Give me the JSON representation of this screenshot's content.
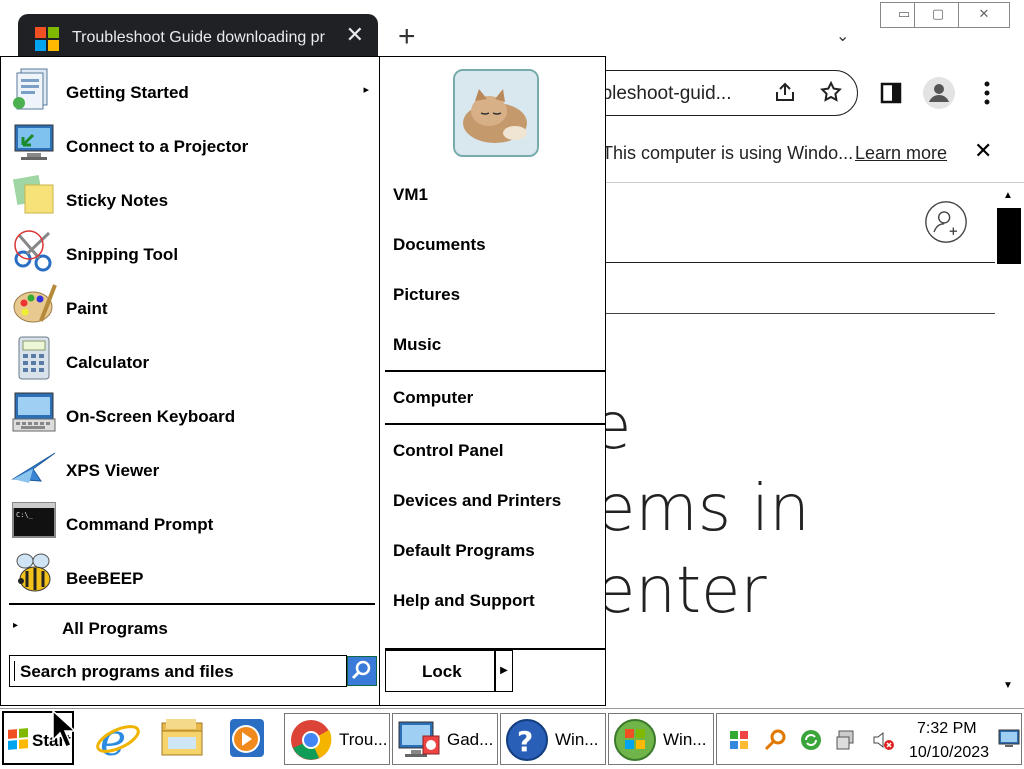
{
  "browser": {
    "tab_title": "Troubleshoot Guide downloading pr",
    "tab_close": "✕",
    "new_tab": "+",
    "tab_search": "⌄",
    "window_controls": {
      "minimize": "▭",
      "maximize": "▢",
      "close": "✕"
    },
    "omnibox_text": "ubleshoot-guid...",
    "infobar_text": "This computer is using Windo...",
    "infobar_link": "Learn more",
    "infobar_close": "✕",
    "page_heading_lines": [
      "e",
      "ems in",
      "enter"
    ]
  },
  "start_menu": {
    "programs": [
      {
        "label": "Getting Started",
        "icon": "getting-started-icon",
        "has_submenu": true
      },
      {
        "label": "Connect to a Projector",
        "icon": "projector-icon"
      },
      {
        "label": "Sticky Notes",
        "icon": "sticky-notes-icon"
      },
      {
        "label": "Snipping Tool",
        "icon": "scissors-icon"
      },
      {
        "label": "Paint",
        "icon": "paint-palette-icon"
      },
      {
        "label": "Calculator",
        "icon": "calculator-icon"
      },
      {
        "label": "On-Screen Keyboard",
        "icon": "keyboard-icon"
      },
      {
        "label": "XPS Viewer",
        "icon": "xps-viewer-icon"
      },
      {
        "label": "Command Prompt",
        "icon": "cmd-icon"
      },
      {
        "label": "BeeBEEP",
        "icon": "bee-icon"
      }
    ],
    "all_programs": "All Programs",
    "search_placeholder": "Search programs and files",
    "right_items": {
      "user": "VM1",
      "documents": "Documents",
      "pictures": "Pictures",
      "music": "Music",
      "computer": "Computer",
      "control_panel": "Control Panel",
      "devices": "Devices and Printers",
      "default_programs": "Default Programs",
      "help": "Help and Support"
    },
    "lock_label": "Lock"
  },
  "taskbar": {
    "start_label": "Start",
    "tasks": [
      {
        "label": "Trou...",
        "icon": "chrome-icon"
      },
      {
        "label": "Gad...",
        "icon": "gadgets-icon"
      },
      {
        "label": "Win...",
        "icon": "help-icon"
      },
      {
        "label": "Win...",
        "icon": "windows-icon"
      }
    ],
    "clock_time": "7:32 PM",
    "clock_date": "10/10/2023"
  },
  "colors": {
    "tab_bg": "#202124",
    "ms_red": "#f25022",
    "ms_green": "#7fba00",
    "ms_blue": "#00a4ef",
    "ms_yellow": "#ffb900"
  }
}
